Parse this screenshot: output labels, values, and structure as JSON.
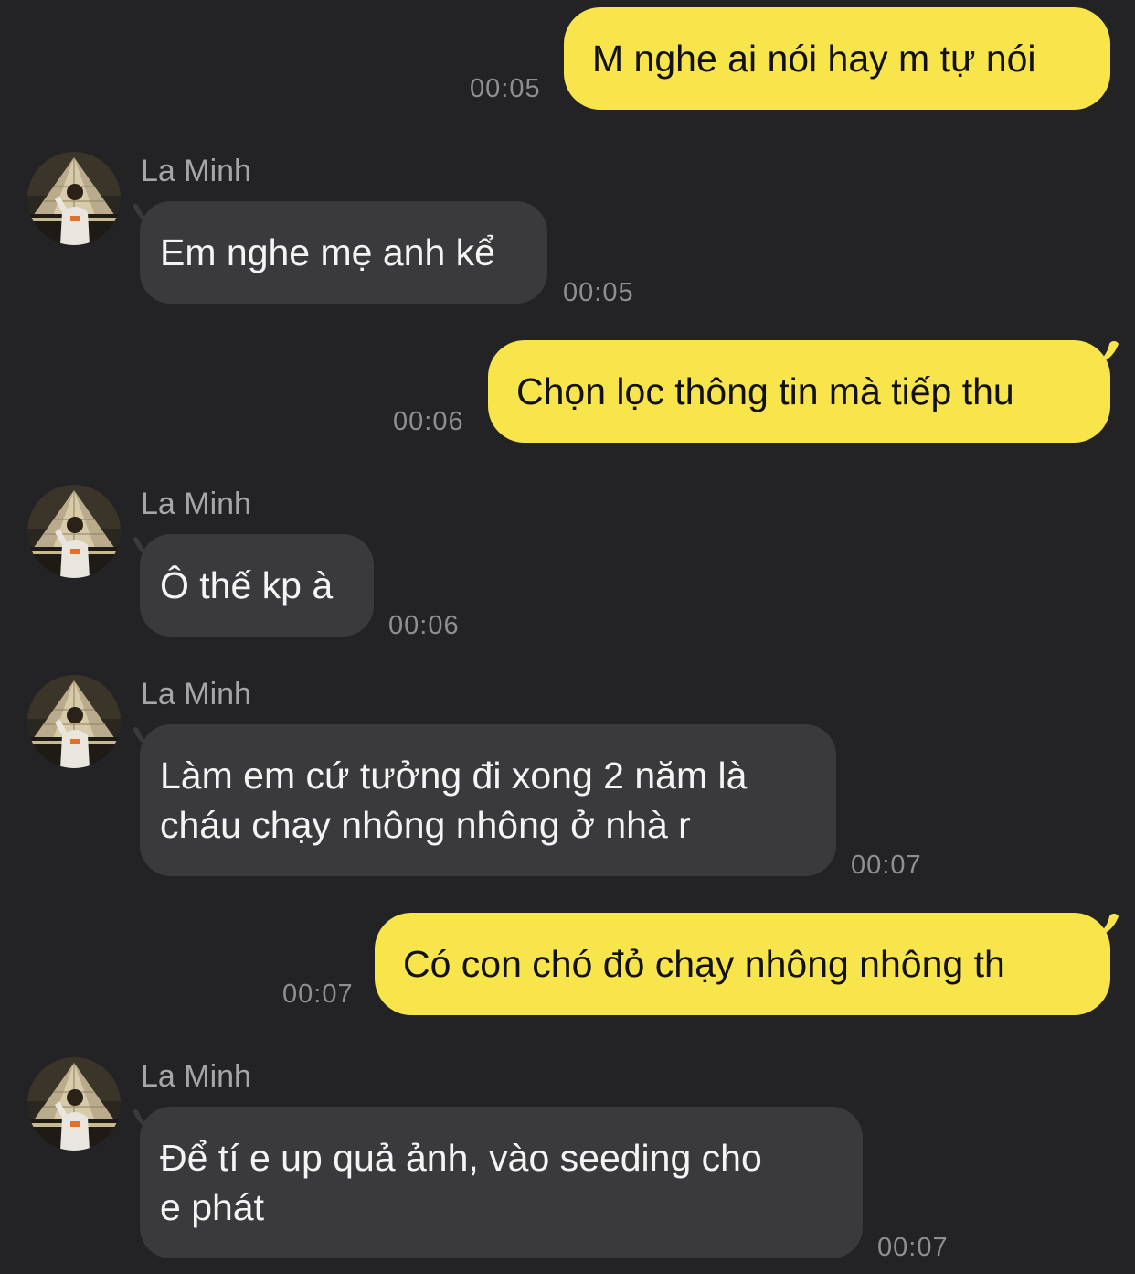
{
  "colors": {
    "background": "#232325",
    "outgoing_bubble": "#F8E44B",
    "incoming_bubble": "#3A3A3C",
    "timestamp": "#8E8E93",
    "sender_name": "#A6A6AA"
  },
  "messages": [
    {
      "direction": "outgoing",
      "text": "M nghe ai nói hay m tự nói",
      "time": "00:05"
    },
    {
      "direction": "incoming",
      "sender": "La Minh",
      "avatar_icon": "avatar-photo",
      "text": "Em nghe mẹ anh kể",
      "time": "00:05"
    },
    {
      "direction": "outgoing",
      "text": "Chọn lọc thông tin mà tiếp thu",
      "time": "00:06"
    },
    {
      "direction": "incoming",
      "sender": "La Minh",
      "avatar_icon": "avatar-photo",
      "text": "Ô thế kp à",
      "time": "00:06"
    },
    {
      "direction": "incoming",
      "sender": "La Minh",
      "avatar_icon": "avatar-photo",
      "lines": [
        "Làm em cứ tưởng đi xong 2 năm là",
        "cháu chạy nhông nhông ở nhà r"
      ],
      "time": "00:07"
    },
    {
      "direction": "outgoing",
      "text": "Có con chó đỏ chạy nhông nhông th",
      "time": "00:07"
    },
    {
      "direction": "incoming",
      "sender": "La Minh",
      "avatar_icon": "avatar-photo",
      "lines": [
        "Để tí e up quả ảnh, vào seeding cho",
        "e phát"
      ],
      "time": "00:07"
    }
  ]
}
